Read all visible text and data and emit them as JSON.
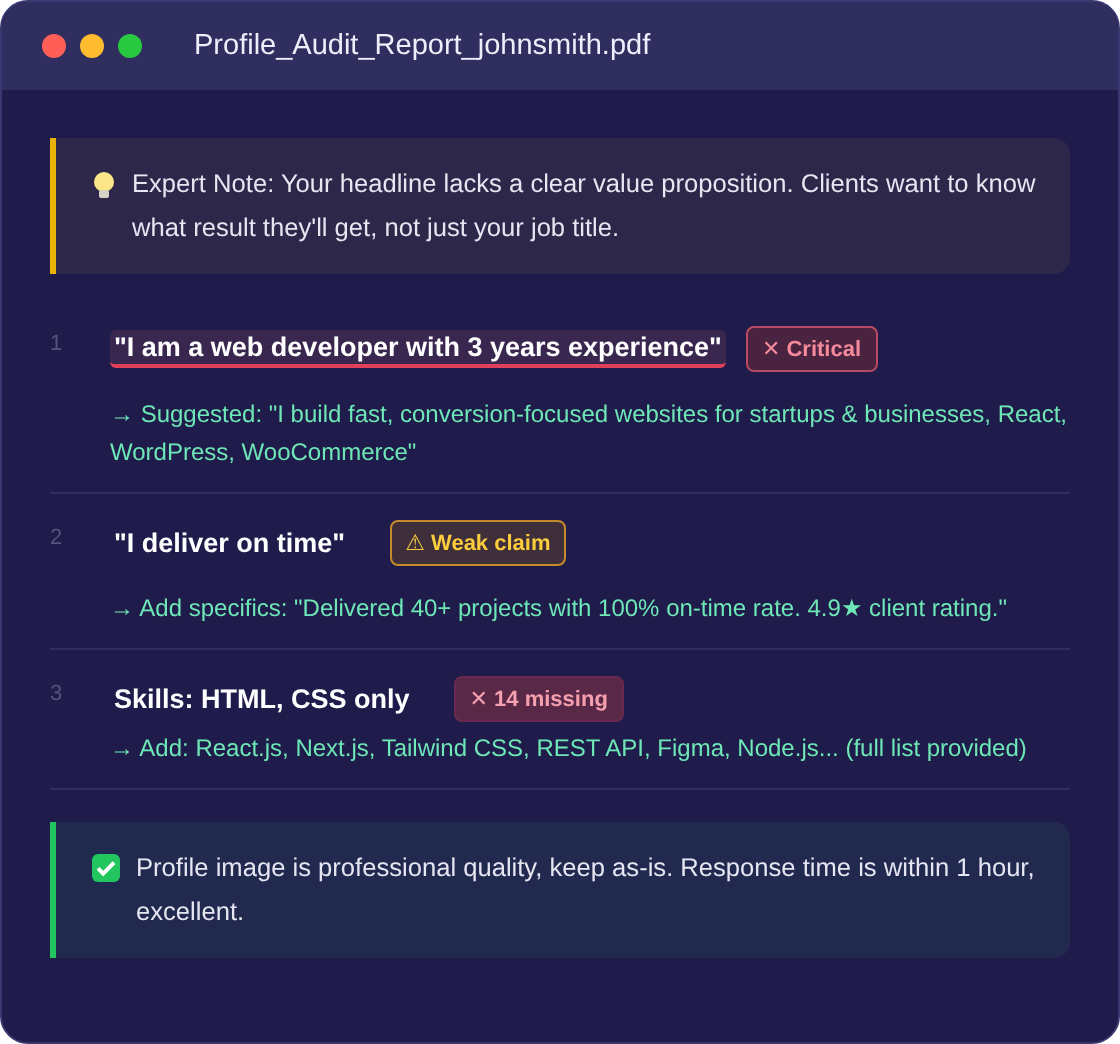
{
  "window": {
    "title": "Profile_Audit_Report_johnsmith.pdf"
  },
  "notes_top": [
    {
      "kind": "tip",
      "text": "Expert Note: Your headline lacks a clear value proposition. Clients want to know what result they'll get, not just your job title."
    }
  ],
  "items": [
    {
      "number": "1",
      "text": "\"I am a web developer with 3 years experience\"",
      "highlighted": true,
      "badge": {
        "kind": "critical",
        "label": "✕ Critical"
      },
      "suggestion": "→ Suggested: \"I build fast, conversion-focused websites for startups & businesses, React, WordPress, WooCommerce\""
    },
    {
      "number": "2",
      "text": "\"I deliver on time\"",
      "highlighted": false,
      "badge": {
        "kind": "warning",
        "label": "⚠ Weak claim"
      },
      "suggestion": "→ Add specifics: \"Delivered 40+ projects with 100% on-time rate. 4.9★ client rating.\""
    },
    {
      "number": "3",
      "text": "Skills: HTML, CSS only",
      "highlighted": false,
      "badge": {
        "kind": "missing",
        "label": "✕ 14 missing"
      },
      "suggestion": "→ Add: React.js, Next.js, Tailwind CSS, REST API, Figma, Node.js... (full list provided)"
    }
  ],
  "notes_bottom": [
    {
      "kind": "success",
      "text": "Profile image is professional quality,  keep as-is. Response time is within 1 hour, excellent."
    }
  ]
}
